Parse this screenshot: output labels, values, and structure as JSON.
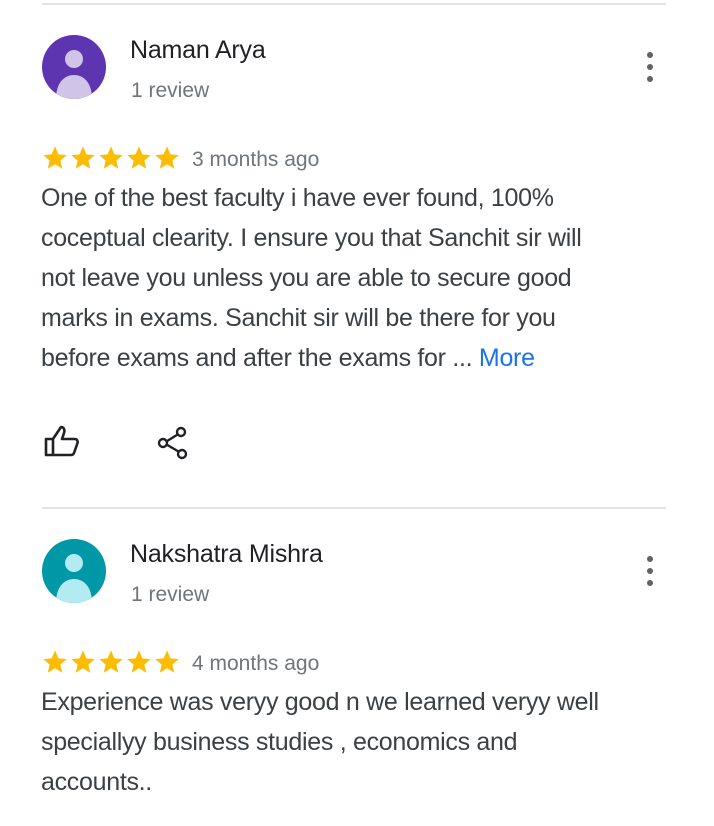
{
  "reviews": [
    {
      "name": "Naman Arya",
      "meta": "1 review",
      "avatar_color": "#5e35b1",
      "avatar_fg": "#d1c4e9",
      "rating": 5,
      "date": "3 months ago",
      "text": "One of the best faculty i have ever found, 100% coceptual clearity. I ensure you that Sanchit sir will not leave you unless you are able to secure good marks in exams. Sanchit sir will be there for you before exams and after the exams  for ... ",
      "more_label": "More"
    },
    {
      "name": "Nakshatra Mishra",
      "meta": "1 review",
      "avatar_color": "#0097a7",
      "avatar_fg": "#b2ebf2",
      "rating": 5,
      "date": "4 months ago",
      "text": "Experience was veryy good n we learned veryy well speciallyy business studies , economics and accounts.."
    }
  ],
  "colors": {
    "star": "#fbbc04",
    "link": "#1a73e8",
    "divider": "#e3e3e3"
  },
  "icons": {
    "menu": "more-vert-icon",
    "like": "thumb-up-icon",
    "share": "share-icon"
  }
}
